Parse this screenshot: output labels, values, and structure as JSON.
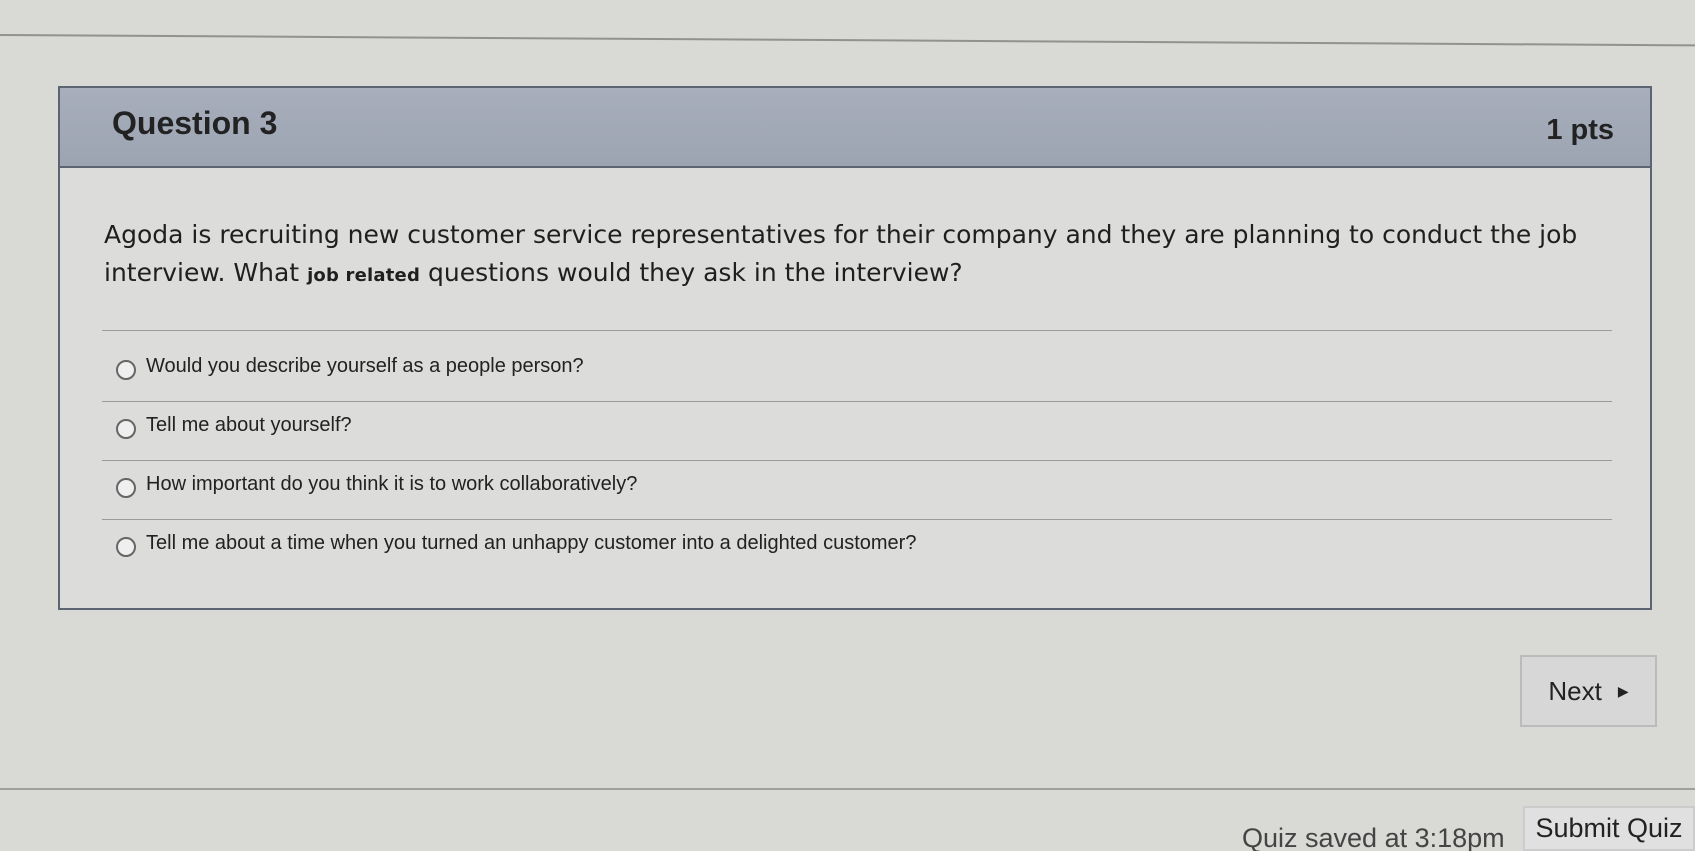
{
  "question": {
    "title": "Question 3",
    "points": "1 pts",
    "text_part1": "Agoda is recruiting new customer service representatives for their company and they are planning to conduct the job interview. What",
    "text_emphasis": "job related",
    "text_part2": "questions would they ask in the interview?"
  },
  "answers": [
    {
      "label": "Would you describe yourself as a people person?"
    },
    {
      "label": "Tell me about yourself?"
    },
    {
      "label": "How important do you think it is to work collaboratively?"
    },
    {
      "label": "Tell me about a time when you turned an unhappy customer into a delighted customer?"
    }
  ],
  "navigation": {
    "next_label": "Next",
    "next_arrow": "▶"
  },
  "footer": {
    "quiz_status": "Quiz saved at 3:18pm",
    "submit_label": "Submit Quiz"
  }
}
